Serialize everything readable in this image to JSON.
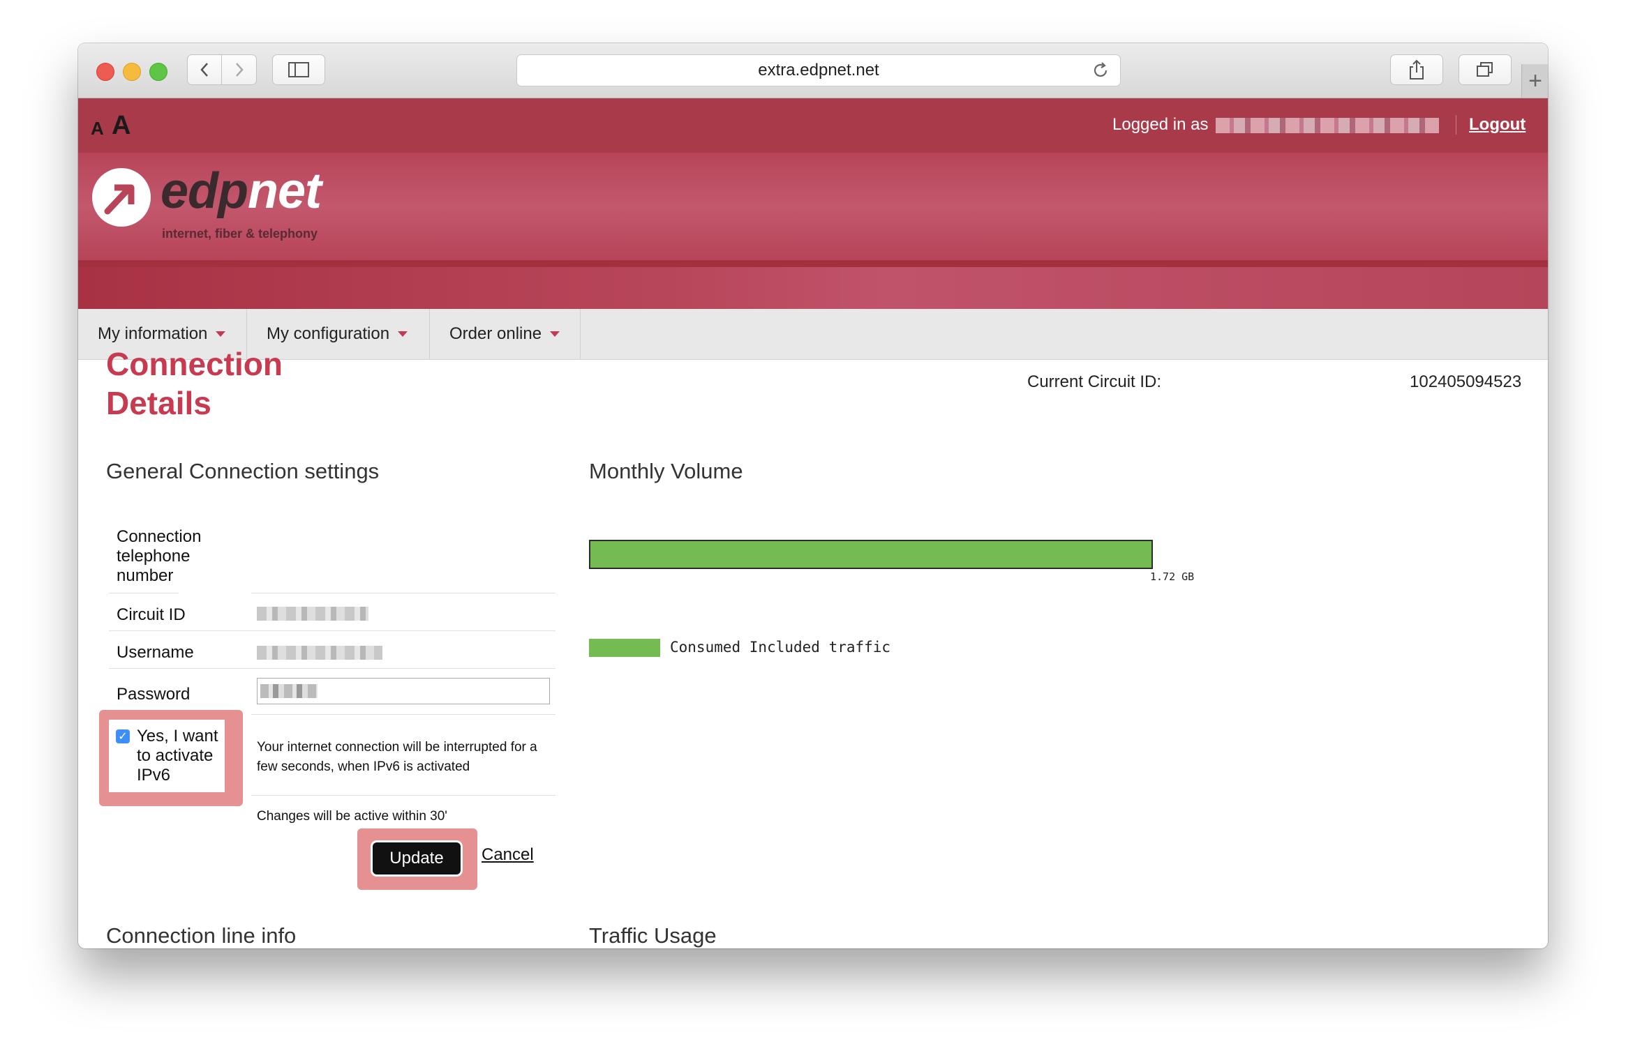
{
  "browser": {
    "url": "extra.edpnet.net"
  },
  "header": {
    "font_small": "A",
    "font_large": "A",
    "logged_in_label": "Logged in as",
    "logout_label": "Logout",
    "logo_prefix": "edp",
    "logo_suffix": "net",
    "tagline": "internet, fiber & telephony"
  },
  "menu": {
    "items": [
      {
        "label": "My information"
      },
      {
        "label": "My configuration"
      },
      {
        "label": "Order online"
      }
    ]
  },
  "page": {
    "title": "Connection Details",
    "circuit_label": "Current Circuit ID:",
    "circuit_value": "102405094523"
  },
  "general": {
    "heading": "General Connection settings",
    "phone_label": "Connection telephone number",
    "circuit_label": "Circuit ID",
    "username_label": "Username",
    "password_label": "Password",
    "ipv6_checked": true,
    "ipv6_label": "Yes, I want to activate IPv6",
    "ipv6_note": "Your internet connection will be interrupted for a few seconds, when IPv6 is activated",
    "changes_note": "Changes will be active within 30'",
    "update_label": "Update",
    "cancel_label": "Cancel"
  },
  "monthly": {
    "heading": "Monthly Volume",
    "volume_text": "1.72 GB",
    "fill_fraction": 1.0,
    "legend_label": "Consumed Included traffic",
    "legend_color": "#74bc52"
  },
  "sections": {
    "line_info": "Connection line info",
    "traffic_usage": "Traffic Usage"
  }
}
